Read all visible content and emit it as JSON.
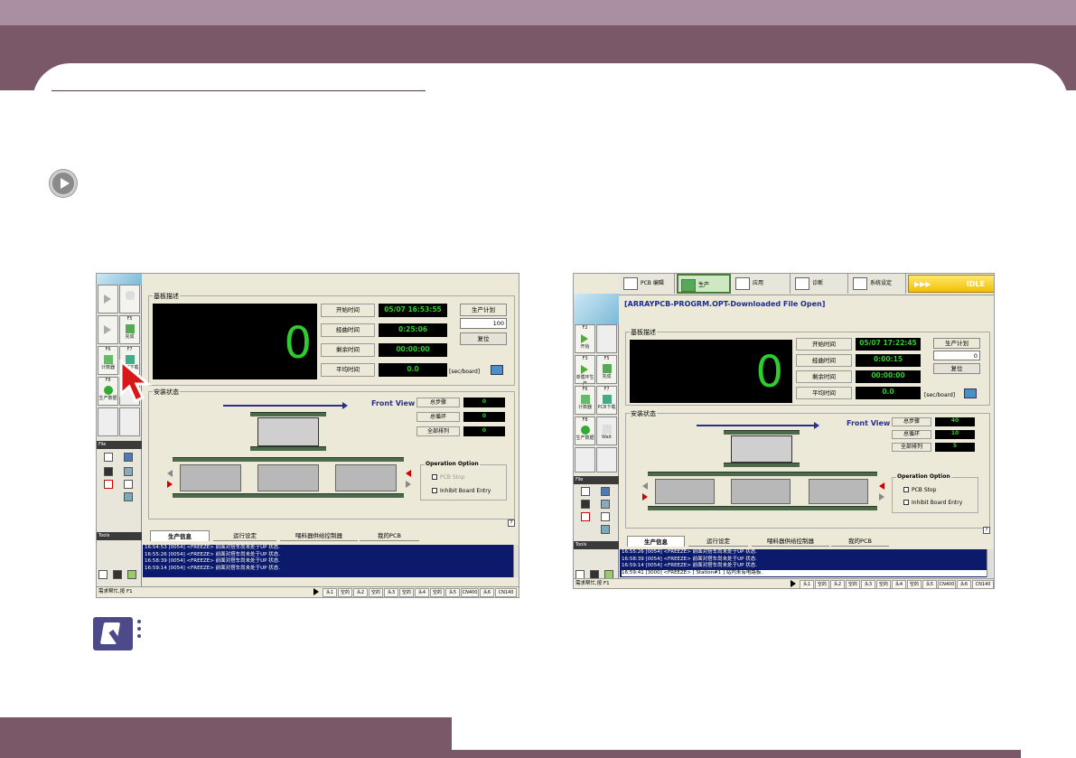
{
  "colors": {
    "brand": "#7a5868",
    "band": "#a98f9f",
    "lcd_green": "#2ecc2e",
    "log_bg": "#0b1a6a",
    "idle": "#f0c000"
  },
  "left": {
    "func_keys": [
      "F5",
      "F6",
      "F7",
      "F8"
    ],
    "func_labels": [
      "完成",
      "计数器",
      "PCB下载",
      "生产数据"
    ],
    "file_label": "File",
    "tools_label": "Tools",
    "board_title": "基板描述",
    "start_label": "开始时间",
    "elapsed_label": "经曲时间",
    "remain_label": "剩余时间",
    "avg_label": "平均时间",
    "start_val": "05/07 16:53:55",
    "elapsed_val": "0:25:06",
    "remain_val": "00:00:00",
    "avg_val": "0.0",
    "plan_label": "生产计划",
    "plan_val": "100",
    "reset_label": "复位",
    "sec_board": "[sec/board]",
    "count": "0",
    "mount_title": "安装状态",
    "front_view": "Front View",
    "stat_labels": [
      "总步骤",
      "总循环",
      "全部排列"
    ],
    "stat_vals": [
      "0",
      "0",
      "0"
    ],
    "op_title": "Operation Option",
    "op1": "PCB Stop",
    "op2": "Inhibit Board Entry",
    "tabs": [
      "生产信息",
      "运行设定",
      "喂料器供给控制器",
      "我的PCB"
    ],
    "log": [
      "16:54:53 [0054] <FREEZE> 前面对搭车尚未处于UP 状态.",
      "16:55:26 [0054] <FREEZE> 前面对搭车尚未处于UP 状态.",
      "16:58:39 [0054] <FREEZE> 前面对搭车尚未处于UP 状态.",
      "16:59:14 [0054] <FREEZE> 前面对搭车尚未处于UP 状态."
    ],
    "status_text": "需求帮忙,按 F1",
    "status_items": [
      "头1",
      "空的",
      "头2",
      "空的",
      "头3",
      "空的",
      "头4",
      "空的",
      "头5",
      "CN400",
      "头6",
      "CN140"
    ],
    "help": "?"
  },
  "right": {
    "toolbar": [
      "PCB 编辑",
      "生产",
      "应用",
      "诊断",
      "系统设定"
    ],
    "idle": "IDLE",
    "file_open": "[ARRAYPCB-PROGRM.OPT-Downloaded File Open]",
    "func_keys": [
      "F2",
      "F3",
      "F5",
      "F6",
      "F7",
      "F8"
    ],
    "func_labels": [
      "开始",
      "单循环生产",
      "完成",
      "计数器",
      "PCB下载",
      "生产数据",
      "Wait"
    ],
    "file_label": "File",
    "tools_label": "Tools",
    "board_title": "基板描述",
    "start_label": "开始时间",
    "elapsed_label": "经曲时间",
    "remain_label": "剩余时间",
    "avg_label": "平均时间",
    "start_val": "05/07 17:22:45",
    "elapsed_val": "0:00:15",
    "remain_val": "00:00:00",
    "avg_val": "0.0",
    "plan_label": "生产计划",
    "plan_val": "0",
    "reset_label": "复位",
    "sec_board": "[sec/board]",
    "count": "0",
    "mount_title": "安装状态",
    "front_view": "Front View",
    "stat_labels": [
      "总步骤",
      "总循环",
      "全部排列"
    ],
    "stat_vals": [
      "40",
      "10",
      "5"
    ],
    "op_title": "Operation Option",
    "op1": "PCB Stop",
    "op2": "Inhibit Board Entry",
    "tabs": [
      "生产信息",
      "运行设定",
      "喂料器供给控制器",
      "我的PCB"
    ],
    "log": [
      "16:55:26 [0054] <FREEZE> 前面对搭车尚未处于UP 状态.",
      "16:58:39 [0054] <FREEZE> 前面对搭车尚未处于UP 状态.",
      "16:59:14 [0054] <FREEZE> 前面对搭车尚未处于UP 状态.",
      "16:59:41 [3000] <FREEZE> [ Station#1 ] 站内未有电路板."
    ],
    "status_text": "需求帮忙,按 F1",
    "status_items": [
      "头1",
      "空的",
      "头2",
      "空的",
      "头3",
      "空的",
      "头4",
      "空的",
      "头5",
      "CN400",
      "头6",
      "CN140"
    ],
    "help": "?"
  }
}
